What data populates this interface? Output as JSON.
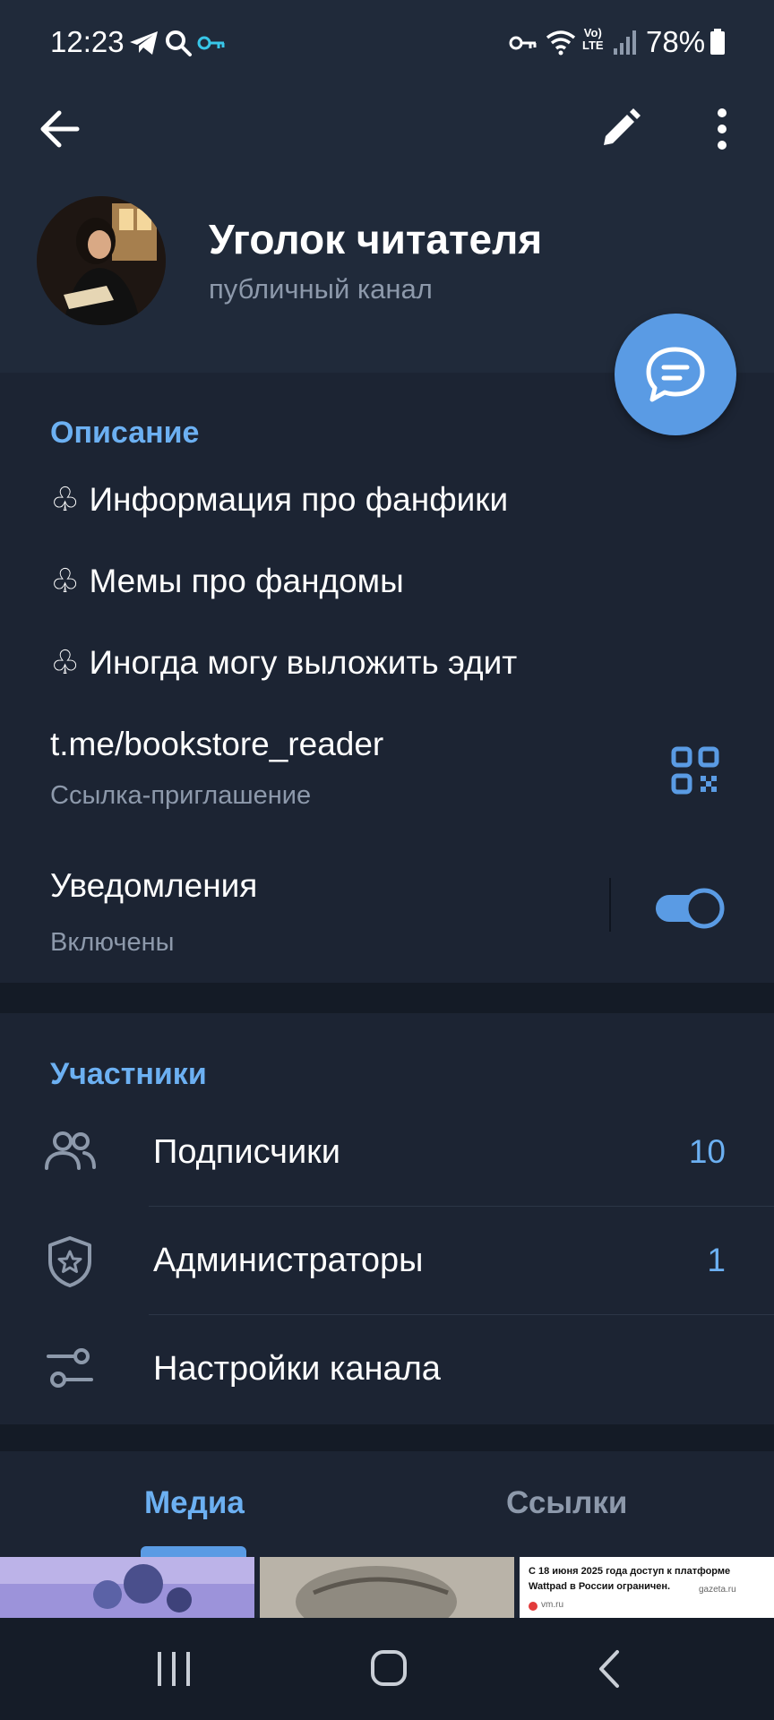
{
  "status_bar": {
    "time": "12:23",
    "battery": "78%",
    "icons": [
      "telegram-icon",
      "search-icon",
      "key-icon",
      "vpn-key-icon",
      "wifi-icon",
      "volte-icon",
      "signal-icon",
      "battery-icon"
    ]
  },
  "header": {
    "title": "Уголок читателя",
    "subtitle": "публичный канал",
    "icons": [
      "back-arrow-icon",
      "edit-pencil-icon",
      "more-vertical-icon"
    ]
  },
  "description": {
    "heading": "Описание",
    "lines": [
      "♧ Информация про фанфики",
      "♧ Мемы про фандомы",
      "♧ Иногда могу выложить эдит"
    ]
  },
  "invite": {
    "link": "t.me/bookstore_reader",
    "label": "Ссылка-приглашение"
  },
  "notifications": {
    "title": "Уведомления",
    "status": "Включены",
    "enabled": true
  },
  "members": {
    "heading": "Участники",
    "rows": [
      {
        "label": "Подписчики",
        "count": "10",
        "icon": "people-icon"
      },
      {
        "label": "Администраторы",
        "count": "1",
        "icon": "admin-shield-icon"
      },
      {
        "label": "Настройки канала",
        "count": "",
        "icon": "settings-sliders-icon"
      }
    ]
  },
  "tabs": [
    {
      "label": "Медиа",
      "active": true
    },
    {
      "label": "Ссылки",
      "active": false
    }
  ],
  "media": {
    "news_card": {
      "headline": "С 18 июня 2025 года доступ к платформе Wattpad в России ограничен.",
      "source1": "gazeta.ru",
      "source2": "vm.ru"
    }
  },
  "colors": {
    "accent": "#6cb0f2",
    "fab": "#5a9be4",
    "background": "#1c2433",
    "header_bg": "#202a3a"
  }
}
